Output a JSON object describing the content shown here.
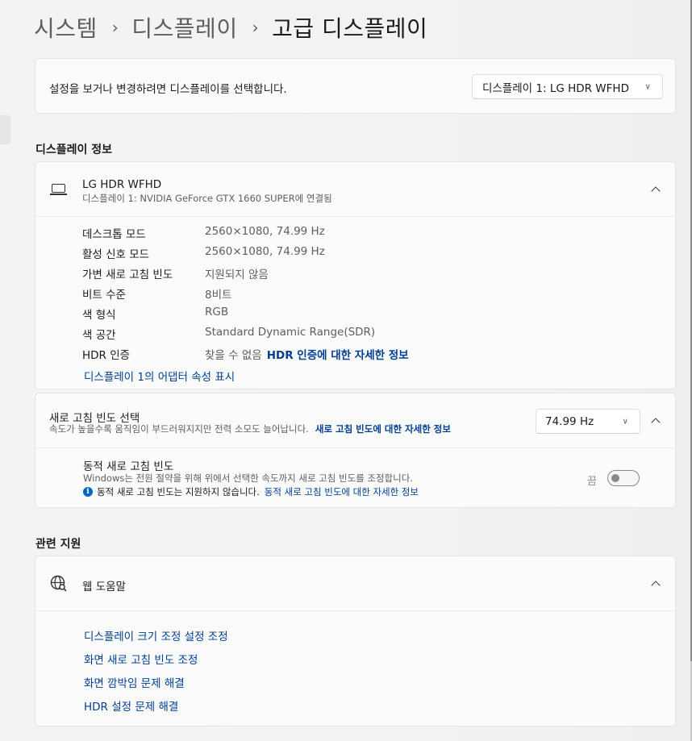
{
  "breadcrumb": {
    "items": [
      "시스템",
      "디스플레이",
      "고급 디스플레이"
    ],
    "separator": "›"
  },
  "display_select": {
    "label": "설정을 보거나 변경하려면 디스플레이를 선택합니다.",
    "selected": "디스플레이 1: LG HDR WFHD"
  },
  "display_info": {
    "section_title": "디스플레이 정보",
    "device_name": "LG HDR WFHD",
    "device_sub": "디스플레이 1: NVIDIA GeForce GTX 1660 SUPER에 연결됨",
    "specs": [
      {
        "key": "데스크톱 모드",
        "value": "2560×1080, 74.99 Hz"
      },
      {
        "key": "활성 신호 모드",
        "value": "2560×1080, 74.99 Hz"
      },
      {
        "key": "가변 새로 고침 빈도",
        "value": "지원되지 않음"
      },
      {
        "key": "비트 수준",
        "value": "8비트"
      },
      {
        "key": "색 형식",
        "value": "RGB"
      },
      {
        "key": "색 공간",
        "value": "Standard Dynamic Range(SDR)"
      },
      {
        "key": "HDR 인증",
        "value": "찾을 수 없음",
        "link": "HDR 인증에 대한 자세한 정보"
      }
    ],
    "adapter_link": "디스플레이 1의 어댑터 속성 표시"
  },
  "refresh": {
    "title": "새로 고침 빈도 선택",
    "desc": "속도가 높을수록 움직임이 부드러워지지만 전력 소모도 늘어납니다.",
    "desc_link": "새로 고침 빈도에 대한 자세한 정보",
    "selected": "74.99 Hz",
    "dynamic": {
      "title": "동적 새로 고침 빈도",
      "desc": "Windows는 전원 절약을 위해 위에서 선택한 속도까지 새로 고침 빈도를 조정합니다.",
      "note": "동적 새로 고침 빈도는 지원하지 않습니다.",
      "note_link": "동적 새로 고침 빈도에 대한 자세한 정보",
      "toggle_label": "끔",
      "toggle_on": false
    }
  },
  "support": {
    "section_title": "관련 지원",
    "head": "웹 도움말",
    "links": [
      "디스플레이 크기 조정 설정 조정",
      "화면 새로 고침 빈도 조정",
      "화면 깜박임 문제 해결",
      "HDR 설정 문제 해결"
    ]
  },
  "icons": {
    "info": "i",
    "chevron_down": "∨"
  },
  "colors": {
    "link": "#003e92",
    "accent": "#0067c0"
  }
}
